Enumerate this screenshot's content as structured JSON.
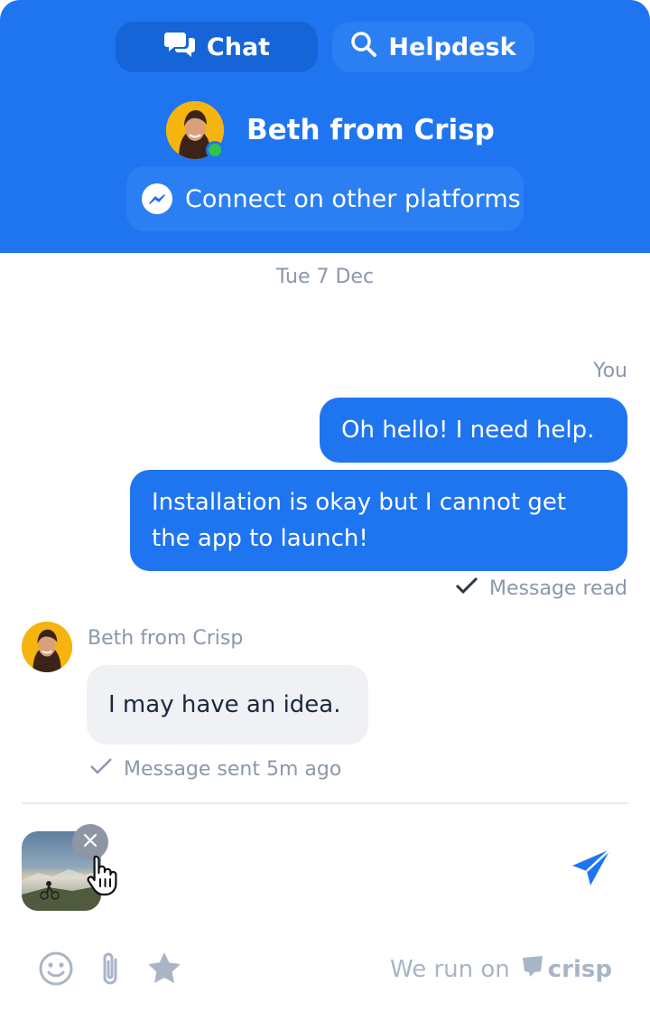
{
  "header": {
    "tabs": [
      {
        "label": "Chat",
        "icon": "chat-bubbles-icon",
        "active": true
      },
      {
        "label": "Helpdesk",
        "icon": "search-icon",
        "active": false
      }
    ],
    "operator_name": "Beth from Crisp",
    "operator_online": true,
    "connect_label": "Connect on other platforms",
    "connect_icon": "messenger-icon"
  },
  "conversation": {
    "date": "Tue 7 Dec",
    "you_label": "You",
    "user_messages": [
      "Oh hello! I need help.",
      "Installation is okay but I cannot get the app to launch!"
    ],
    "read_status": "Message read",
    "operator_name": "Beth from Crisp",
    "operator_message": "I may have an idea.",
    "sent_status": "Message sent 5m ago"
  },
  "composer": {
    "attachment_icon": "photo-thumbnail",
    "remove_icon": "close-icon",
    "send_icon": "send-icon",
    "tools": [
      "emoji-icon",
      "paperclip-icon",
      "star-icon"
    ]
  },
  "branding": {
    "prefix": "We run on",
    "brand": "crisp"
  },
  "colors": {
    "primary": "#1f75f0",
    "online": "#30c44a",
    "muted_text": "#8a98ab",
    "operator_bubble": "#eff1f5"
  }
}
